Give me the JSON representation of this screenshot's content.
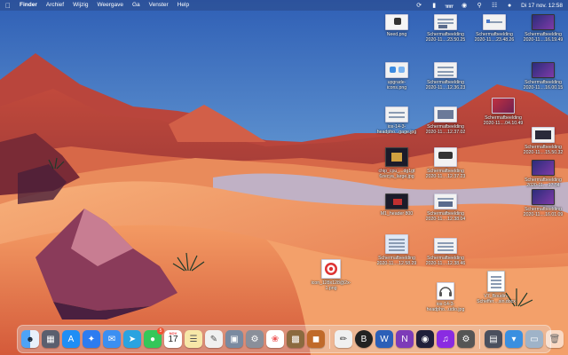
{
  "menubar": {
    "app_name": "Finder",
    "menus": [
      "Archief",
      "Wijzig",
      "Weergave",
      "Ga",
      "Venster",
      "Help"
    ],
    "clock": "Di 17 nov.  12:58"
  },
  "desktop": {
    "icons": [
      "Need.png",
      "Schermafbeelding\n2020-11....23.50.25",
      "Schermafbeelding\n2020-11....23.48.26",
      "Schermafbeelding\n2020-11....16.19.49",
      "upgrade-\nicons.png",
      "Schermafbeelding\n2020-11....12.36.23",
      "Schermafbeelding\n2020-11....16.00.15",
      "ios-14-3-\nheadpho...gage.jpg",
      "Schermafbeelding\n2020-11....12.37.02",
      "Schermafbeelding\n2020-11....04.10.49",
      "Schermafbeelding\n2020-11....15.50.32",
      "chip_cpu_...dg1gt\n6zecya_large.jpg",
      "Schermafbeelding\n2020-11....12.37.23",
      "Schermafbeelding\n2020-11....17.54",
      "M1_header 800",
      "Schermafbeelding\n2020-11....12.38.04",
      "Schermafbeelding\n2020-11....16.01.09",
      "Schermafbeelding\n2020-11....12.58.29",
      "Schermafbeelding\n2020-11....12.38.46",
      "icon_128x128@2x-\n1.png",
      "ios-14-3-\nheadpho...udio.jpg",
      "V7_Boudin-\nScheffer....sin.docx"
    ]
  },
  "dock": {
    "messages_badge": "5",
    "calendar_month": "NOV",
    "calendar_day": "17"
  },
  "colors": {
    "sky_top": "#2f64b8",
    "sand": "#e0764a",
    "rock": "#9a3b3a"
  }
}
